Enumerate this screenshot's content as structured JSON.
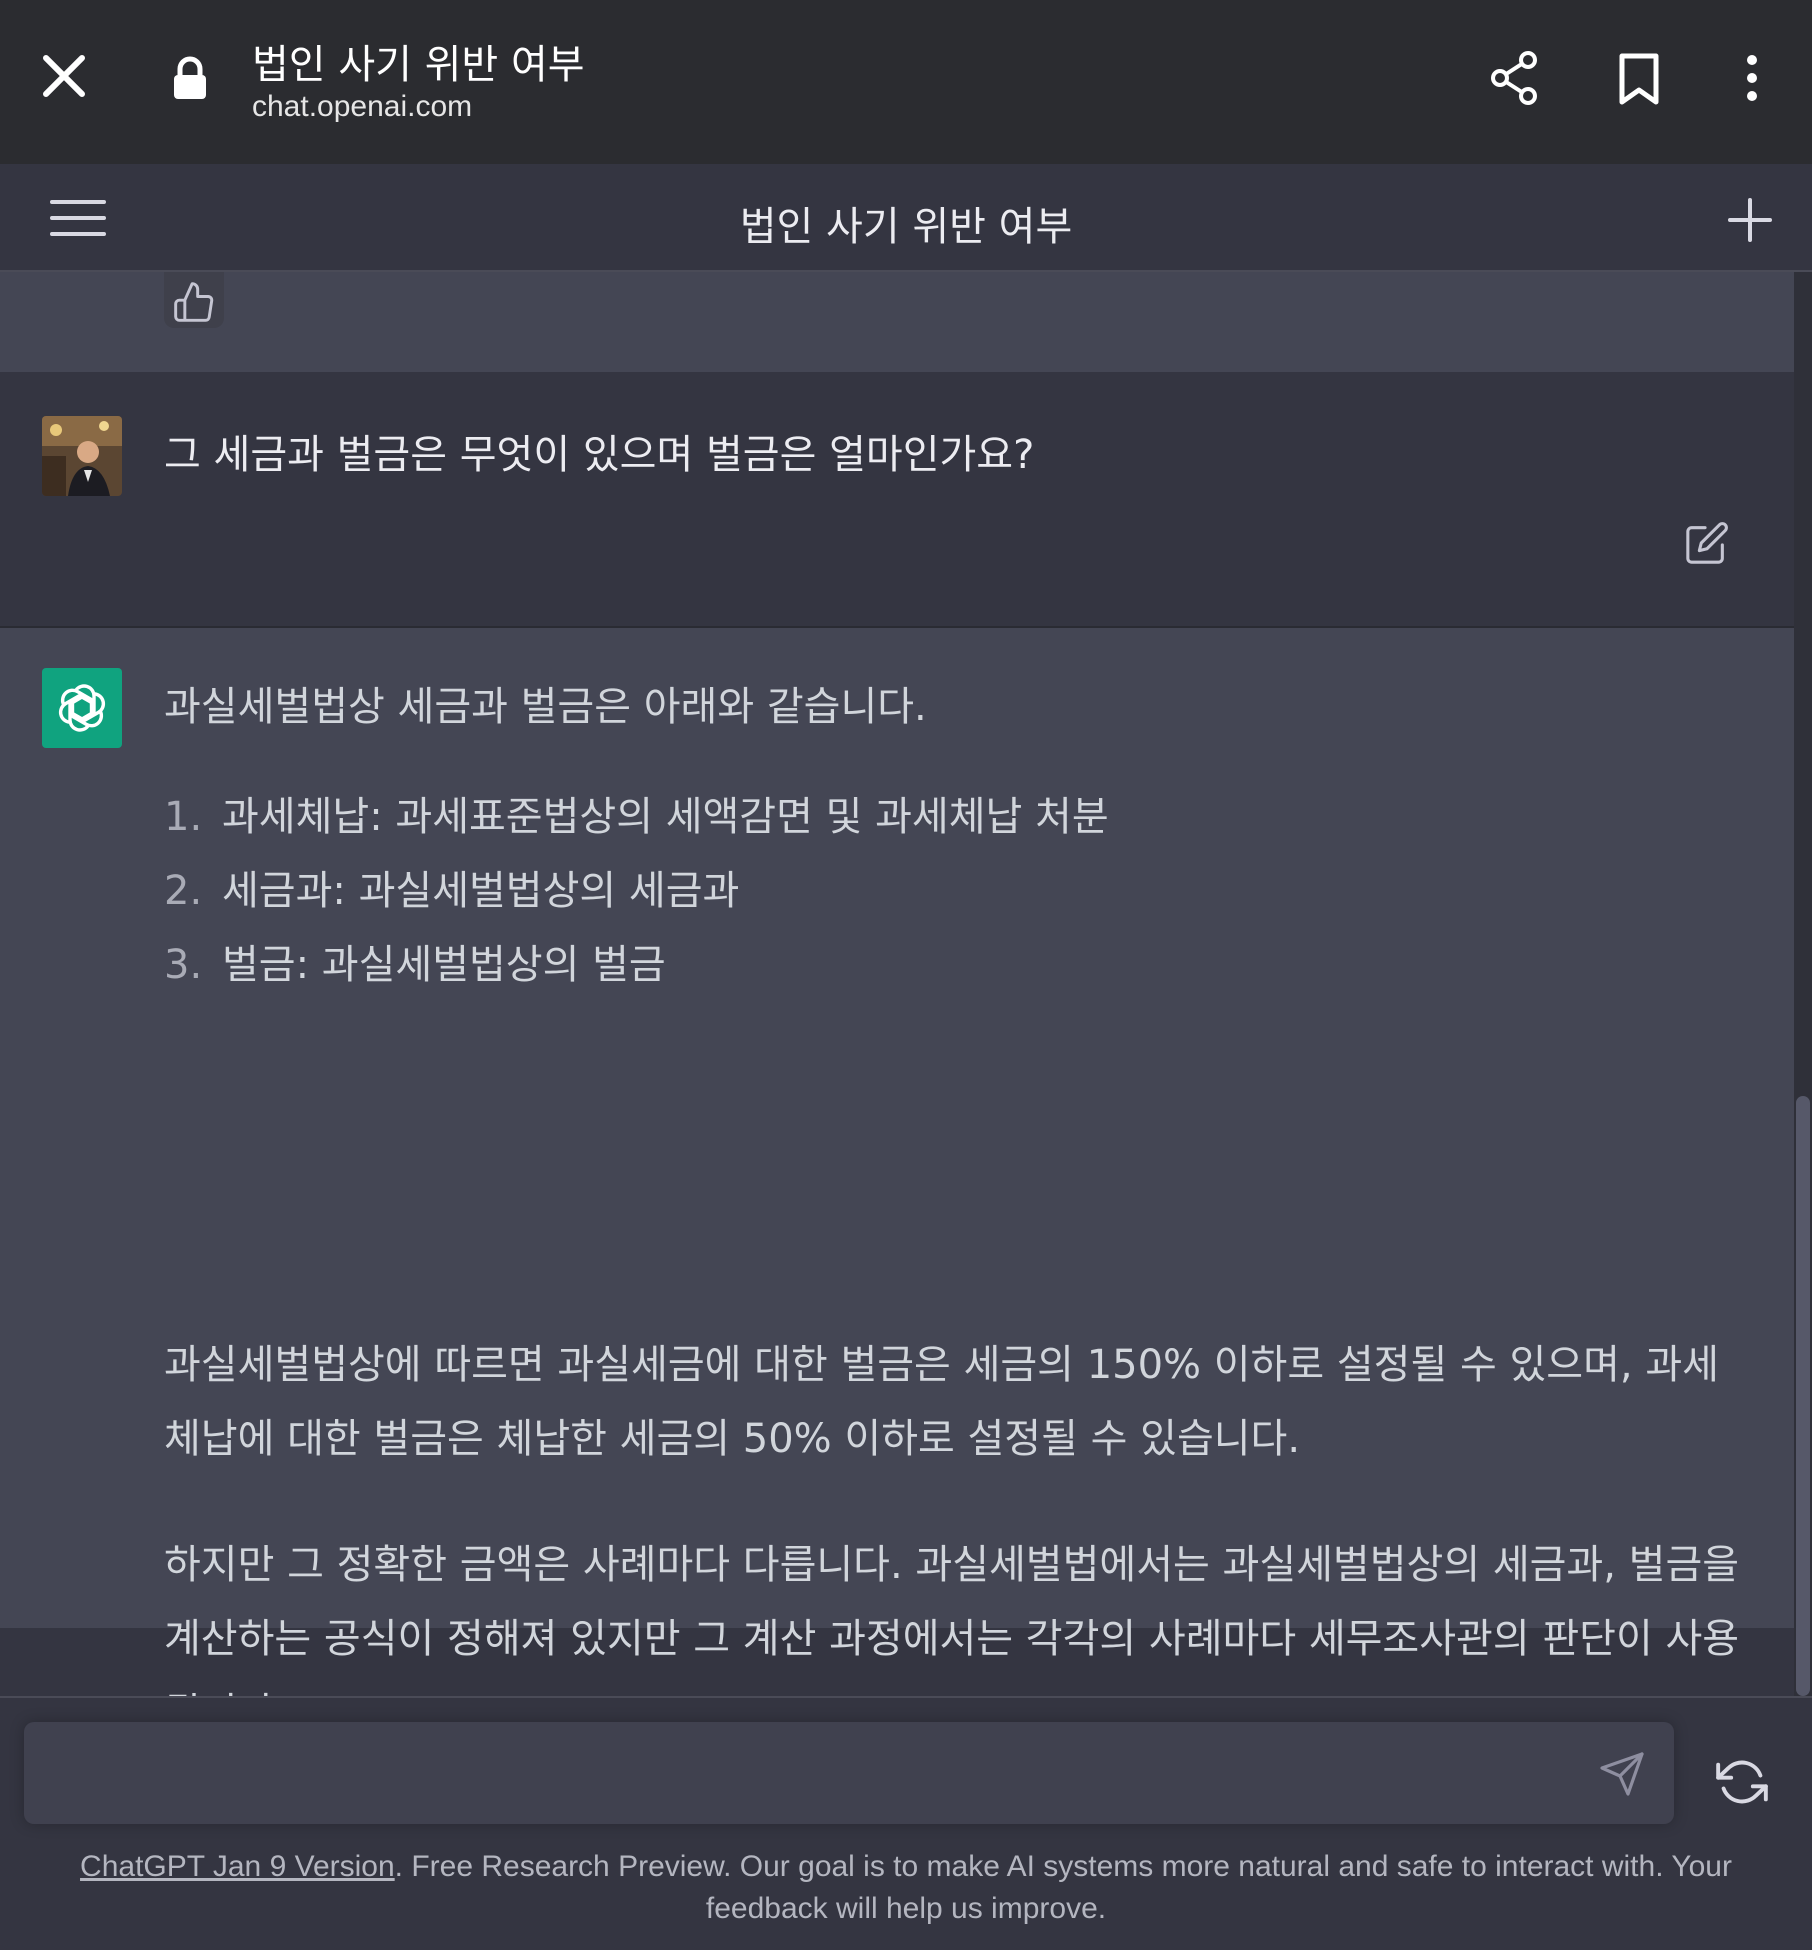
{
  "browser": {
    "page_title": "법인 사기 위반 여부",
    "url": "chat.openai.com"
  },
  "header": {
    "title": "법인 사기 위반 여부"
  },
  "user_message": {
    "text": "그 세금과 벌금은 무엇이 있으며 벌금은 얼마인가요?"
  },
  "assistant_message": {
    "intro": "과실세벌법상 세금과 벌금은 아래와 같습니다.",
    "list": [
      {
        "num": "1.",
        "text": "과세체납: 과세표준법상의 세액감면 및 과세체납 처분"
      },
      {
        "num": "2.",
        "text": "세금과: 과실세벌법상의 세금과"
      },
      {
        "num": "3.",
        "text": "벌금: 과실세벌법상의 벌금"
      }
    ],
    "paragraph1": "과실세벌법상에 따르면 과실세금에 대한 벌금은 세금의 150% 이하로 설정될 수 있으며, 과세체납에 대한 벌금은 체납한 세금의 50% 이하로 설정될 수 있습니다.",
    "paragraph2": "하지만 그 정확한 금액은 사례마다 다릅니다. 과실세벌법에서는 과실세벌법상의 세금과, 벌금을 계산하는 공식이 정해져 있지만 그 계산 과정에서는 각각의 사례마다 세무조사관의 판단이 사용됩니다."
  },
  "composer": {
    "input_value": "",
    "placeholder": ""
  },
  "footer": {
    "link_text": "ChatGPT Jan 9 Version",
    "text": ". Free Research Preview. Our goal is to make AI systems more natural and safe to interact with. Your feedback will help us improve."
  },
  "colors": {
    "browser_bar": "#2b2c30",
    "background": "#343541",
    "assistant_background": "#444654",
    "brand_green": "#10a37f"
  },
  "icons": [
    "close-icon",
    "lock-icon",
    "share-icon",
    "bookmark-icon",
    "more-vert-icon",
    "hamburger-menu-icon",
    "plus-icon",
    "thumbs-up-icon",
    "thumbs-down-icon",
    "edit-icon",
    "openai-logo-icon",
    "send-icon",
    "regenerate-icon"
  ]
}
